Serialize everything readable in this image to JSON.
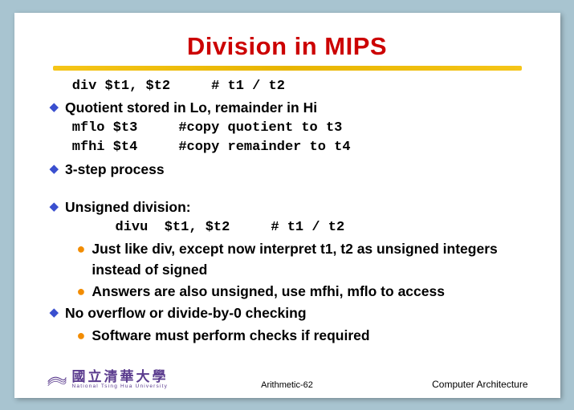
{
  "title": "Division in MIPS",
  "lines": {
    "code1": " div $t1, $t2     # t1 / t2",
    "b1": "Quotient stored in Lo, remainder in Hi",
    "code2": " mflo $t3     #copy quotient to t3",
    "code3": " mfhi $t4     #copy remainder to t4",
    "b2": "3-step process",
    "b3": "Unsigned division:",
    "code4": "divu  $t1, $t2     # t1 / t2",
    "sub1": "Just like div, except now interpret t1, t2 as unsigned integers instead of signed",
    "sub2": "Answers are also unsigned, use mfhi, mflo to access",
    "b4": "No overflow or divide-by-0 checking",
    "sub3": "Software must perform checks if required"
  },
  "footer": {
    "logo_ch": "國立清華大學",
    "logo_en": "National Tsing Hua University",
    "center": "Arithmetic-62",
    "right": "Computer Architecture"
  }
}
